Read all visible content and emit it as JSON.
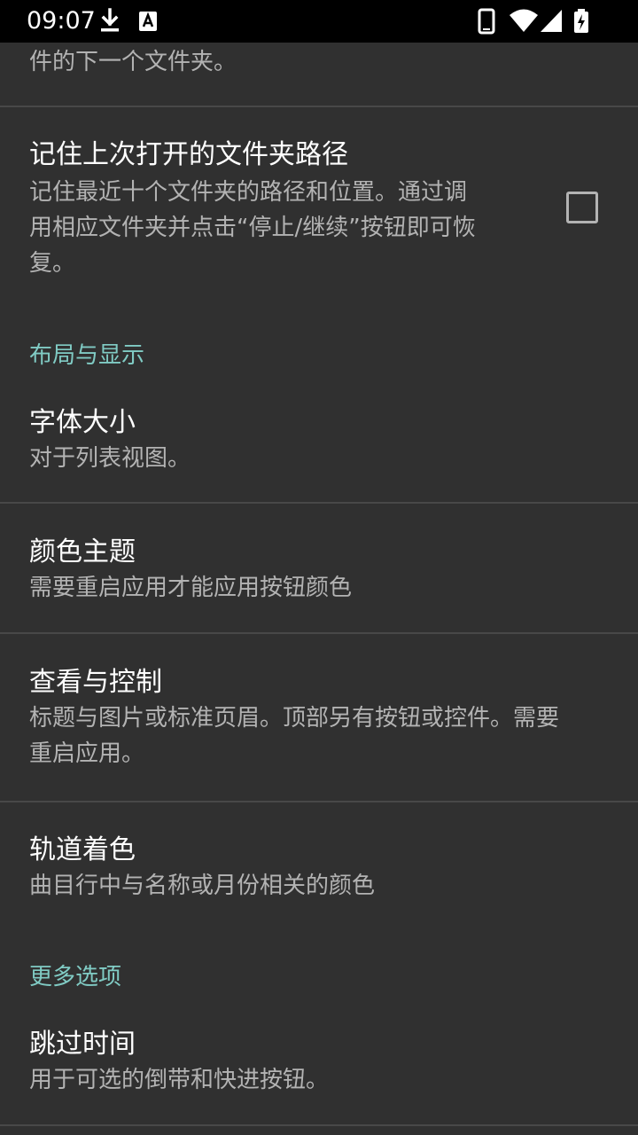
{
  "status_bar": {
    "time": "09:07",
    "left_icons": [
      "download-icon",
      "font-notification-icon"
    ],
    "right_icons": [
      "phone-icon",
      "wifi-icon",
      "cell-signal-icon",
      "battery-charging-icon"
    ]
  },
  "colors": {
    "background": "#303030",
    "status_bar": "#000000",
    "accent": "#80cbc4",
    "divider": "#484848",
    "title": "#ffffff",
    "summary": "#b3b3b3"
  },
  "settings": {
    "top_partial_summary": "件的下一个文件夹。",
    "remember_folder": {
      "title": "记住上次打开的文件夹路径",
      "summary_lines": [
        "记住最近十个文件夹的路径和位置。通过调",
        "用相应文件夹并点击“停止/继续”按钮即可恢",
        "复。"
      ],
      "checked": false
    },
    "category_layout": "布局与显示",
    "font_size": {
      "title": "字体大小",
      "summary": "对于列表视图。"
    },
    "color_theme": {
      "title": "颜色主题",
      "summary": "需要重启应用才能应用按钮颜色"
    },
    "view_control": {
      "title": "查看与控制",
      "summary_lines": [
        "标题与图片或标准页眉。顶部另有按钮或控件。需要",
        "重启应用。"
      ]
    },
    "track_coloring": {
      "title": "轨道着色",
      "summary": "曲目行中与名称或月份相关的颜色"
    },
    "category_more": "更多选项",
    "skip_time": {
      "title": "跳过时间",
      "summary": "用于可选的倒带和快进按钮。"
    }
  }
}
